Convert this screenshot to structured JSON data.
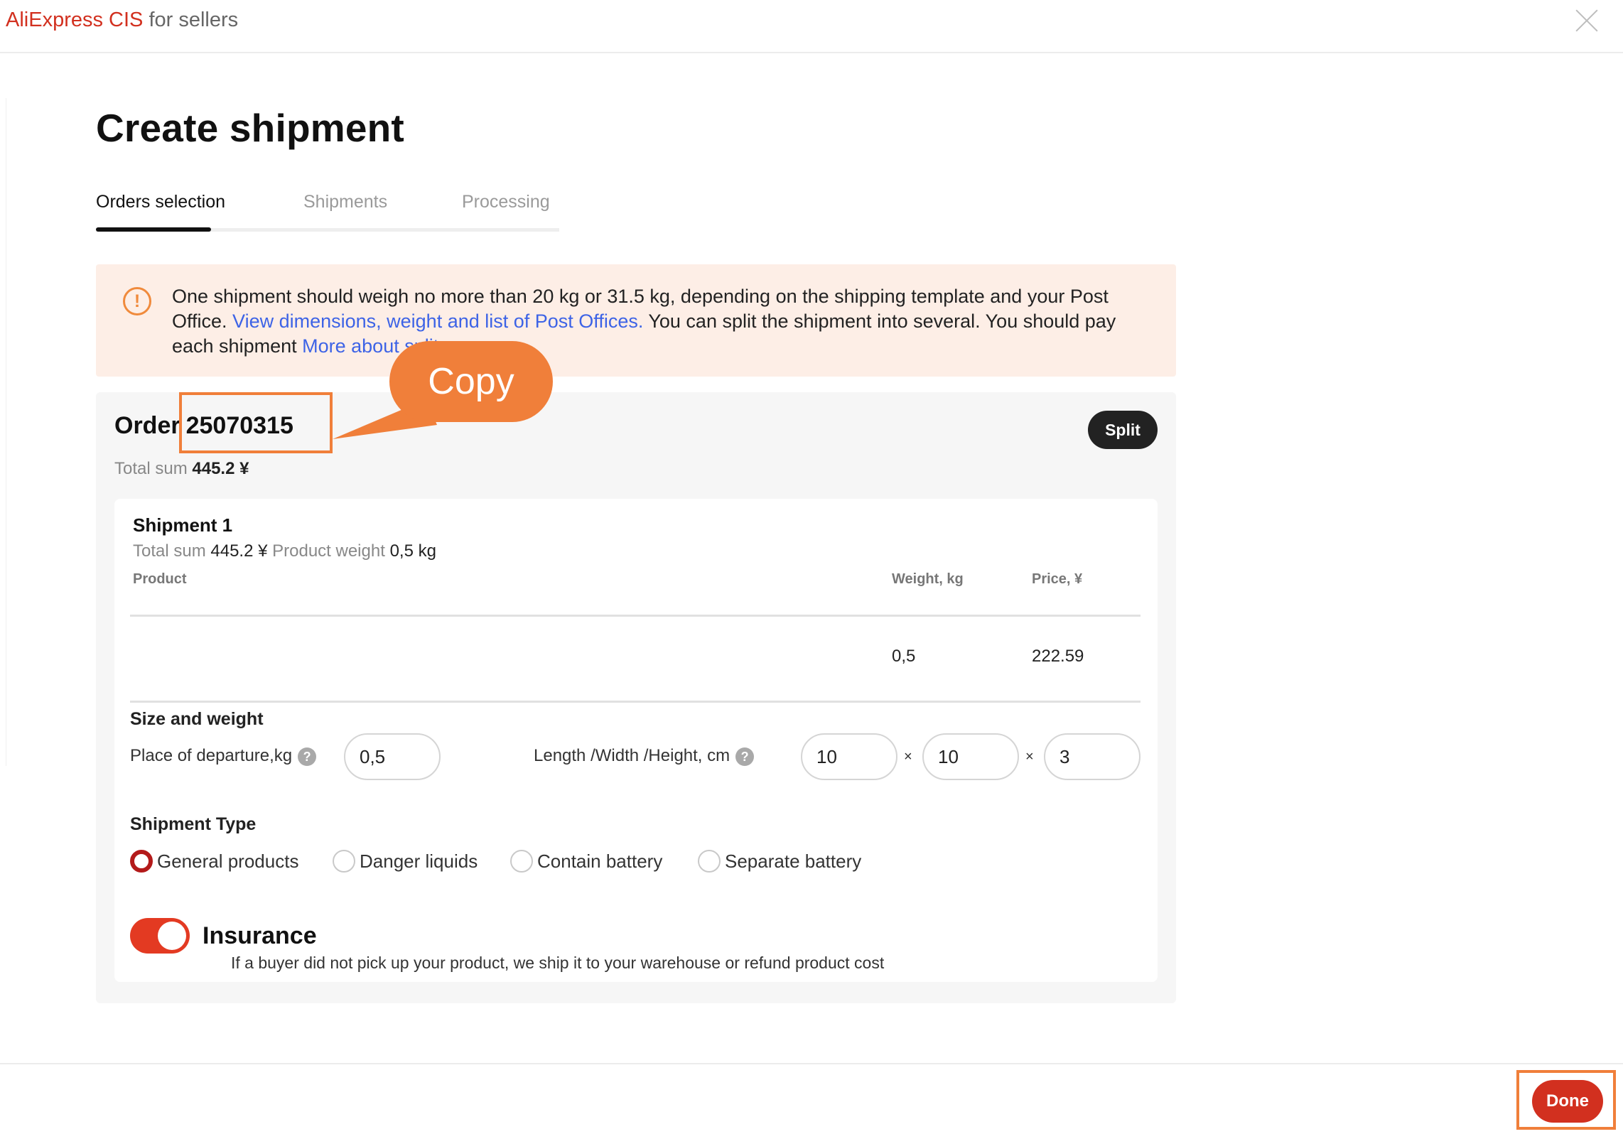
{
  "header": {
    "brand_name": "AliExpress CIS",
    "brand_suffix": " for sellers"
  },
  "page": {
    "title": "Create shipment"
  },
  "tabs": [
    {
      "label": "Orders selection",
      "active": true
    },
    {
      "label": "Shipments",
      "active": false
    },
    {
      "label": "Processing",
      "active": false
    }
  ],
  "notice": {
    "text_1": "One shipment should weigh no more than 20 kg or 31.5 kg, depending on the shipping template and your Post Office. ",
    "link_1": "View dimensions, weight and list of Post Offices.",
    "text_2": " You can split the shipment into several. You should pay each shipment",
    "link_2": "More about split"
  },
  "order": {
    "label": "Order",
    "number": "25070315",
    "total_label": "Total sum",
    "total_value": "445.2 ¥",
    "split_label": "Split"
  },
  "shipment": {
    "title": "Shipment 1",
    "total_label": "Total sum",
    "total_value": "445.2 ¥",
    "weight_label": "Product weight",
    "weight_value": "0,5 kg",
    "columns": {
      "product": "Product",
      "weight": "Weight, kg",
      "price": "Price, ¥"
    },
    "rows": [
      {
        "product": "",
        "weight": "0,5",
        "price": "222.59"
      }
    ]
  },
  "size_weight": {
    "title": "Size and weight",
    "departure_label": "Place of departure,kg",
    "departure_value": "0,5",
    "dims_label": "Length /Width /Height, cm",
    "length": "10",
    "width": "10",
    "height": "3",
    "times": "×"
  },
  "shipment_type": {
    "title": "Shipment Type",
    "options": [
      {
        "label": "General products",
        "selected": true
      },
      {
        "label": "Danger liquids",
        "selected": false
      },
      {
        "label": "Contain battery",
        "selected": false
      },
      {
        "label": "Separate battery",
        "selected": false
      }
    ]
  },
  "insurance": {
    "title": "Insurance",
    "enabled": true,
    "description": "If a buyer did not pick up your product, we ship it to your warehouse or refund product cost"
  },
  "annotation": {
    "callout_text": "Copy"
  },
  "footer": {
    "done_label": "Done"
  },
  "colors": {
    "brand": "#d2301f",
    "accent_orange": "#f07f3a",
    "link": "#3d63e6",
    "notice_bg": "#fdeee6",
    "toggle_on": "#e33a22"
  },
  "icons": {
    "close": "close-icon",
    "warning": "warning-circle-icon",
    "help": "help-icon"
  }
}
